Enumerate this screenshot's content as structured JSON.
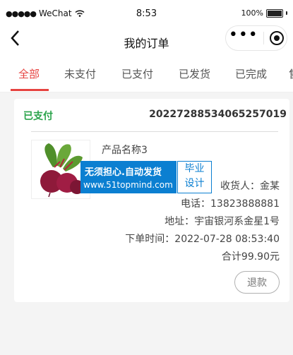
{
  "status_bar": {
    "carrier": "WeChat",
    "time": "8:53",
    "battery": "100%"
  },
  "nav": {
    "title": "我的订单"
  },
  "tabs": [
    {
      "label": "全部",
      "active": true
    },
    {
      "label": "未支付"
    },
    {
      "label": "已支付"
    },
    {
      "label": "已发货"
    },
    {
      "label": "已完成"
    }
  ],
  "order": {
    "status": "已支付",
    "order_no": "20227288534065257019",
    "product_name": "产品名称3",
    "receiver": "收货人：金某",
    "phone": "电话：13823888881",
    "address": "地址：宇宙银河系金星1号",
    "order_time": "下单时间：2022-07-28 08:53:40",
    "total": "合计99.90元",
    "refund_label": "退款"
  },
  "watermark": {
    "line1": "无须担心.自动发货",
    "line2": "www.51topmind.com",
    "box_line1": "毕业",
    "box_line2": "设计"
  },
  "colors": {
    "accent": "#e64340",
    "paid_green": "#2aa34a",
    "watermark_blue": "#0b7fd1"
  }
}
